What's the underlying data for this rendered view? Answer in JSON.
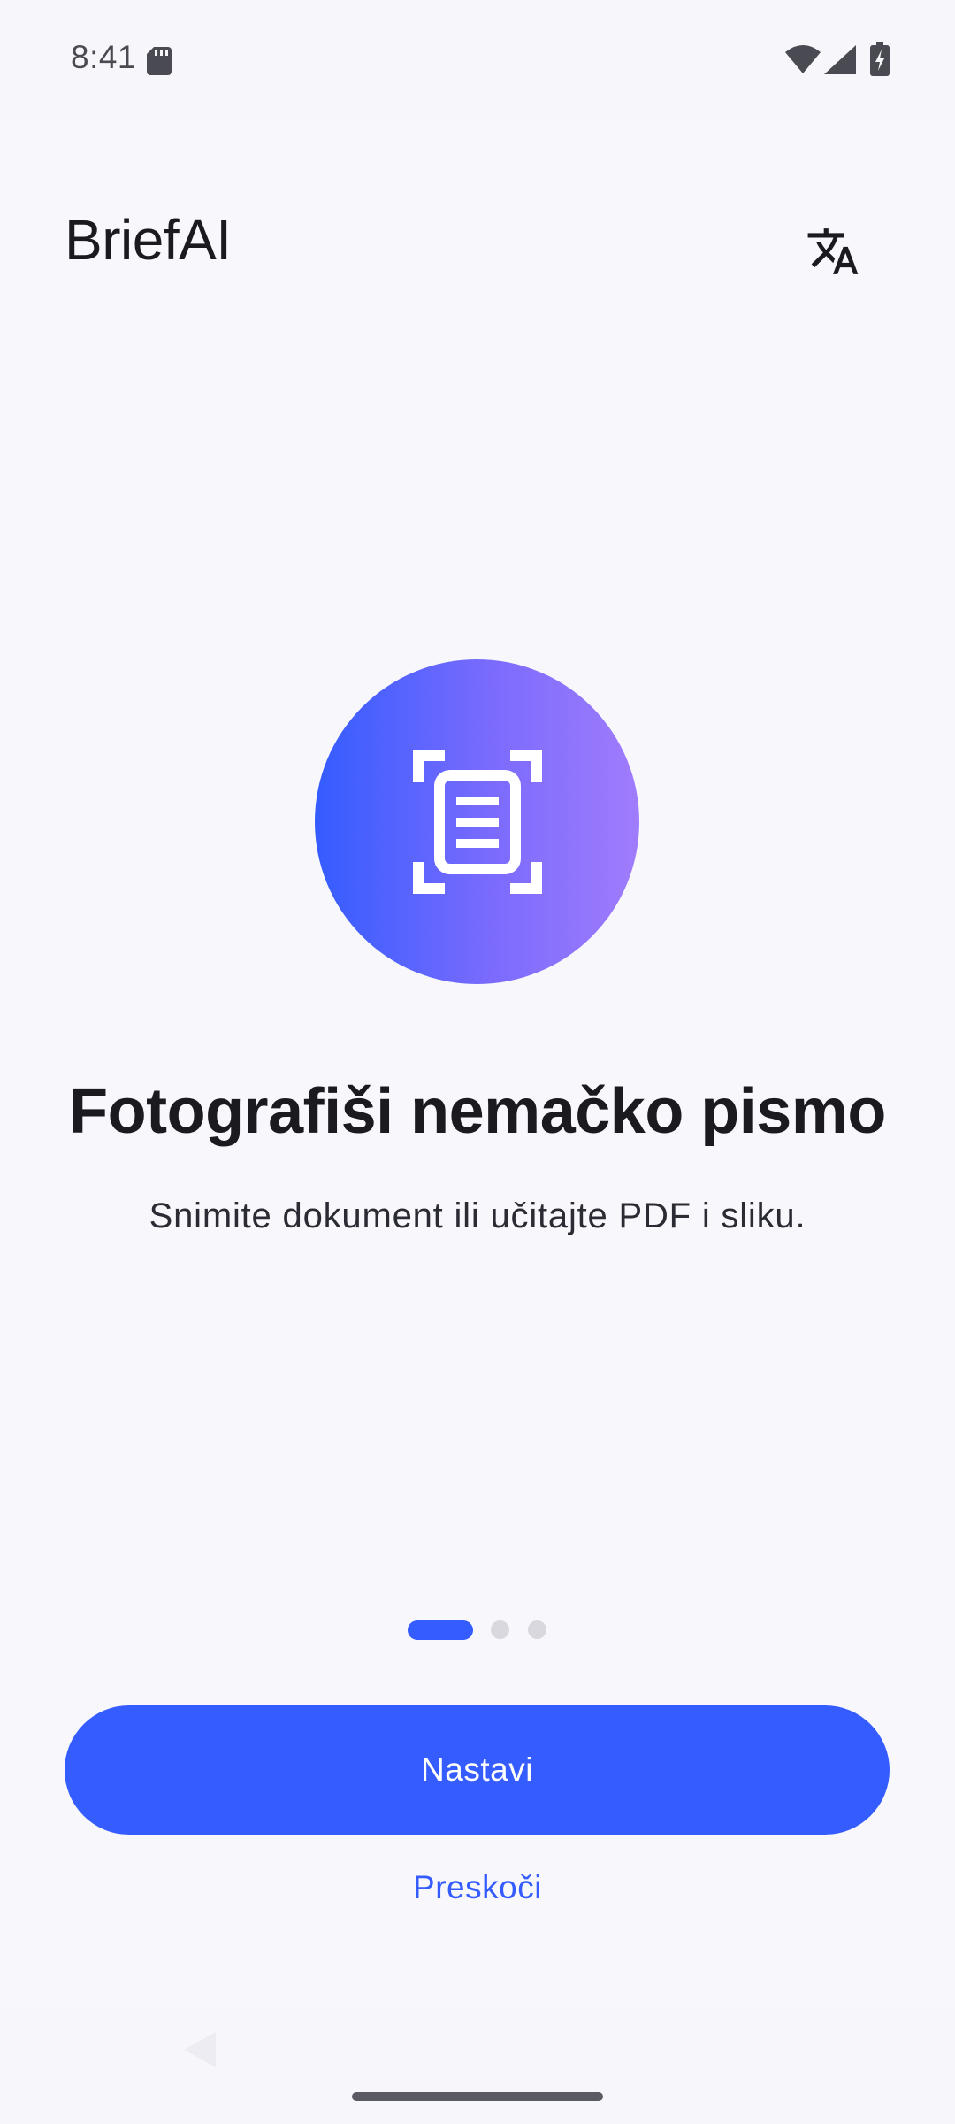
{
  "status_bar": {
    "time": "8:41",
    "icons": [
      "sd-card-icon",
      "wifi-icon",
      "cell-signal-icon",
      "battery-charging-icon"
    ]
  },
  "header": {
    "app_title": "BriefAI",
    "language_icon": "translate-icon"
  },
  "onboarding": {
    "hero_icon": "document-scan-icon",
    "title": "Fotografiši nemačko pismo",
    "subtitle": "Snimite dokument ili učitajte PDF i sliku.",
    "page_indicator": {
      "current": 1,
      "total": 3
    }
  },
  "actions": {
    "continue_label": "Nastavi",
    "skip_label": "Preskoči"
  },
  "nav": {
    "icons": [
      "back-icon",
      "home-handle"
    ]
  },
  "colors": {
    "accent": "#345cff",
    "gradient_start": "#345cff",
    "gradient_end": "#a07cfc",
    "background": "#f7f7fc",
    "dot_inactive": "#d8d8de"
  }
}
